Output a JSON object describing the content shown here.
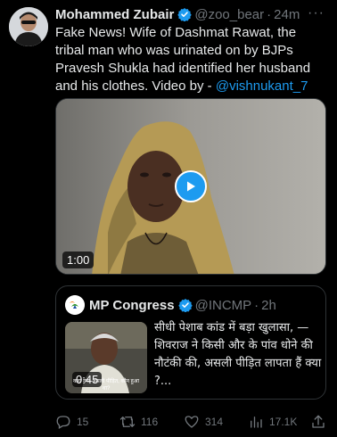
{
  "tweet": {
    "author_name": "Mohammed Zubair",
    "handle": "@zoo_bear",
    "separator": "·",
    "time": "24m",
    "more": "···",
    "text": "Fake News! Wife of Dashmat Rawat,  the tribal man who was urinated on by BJPs Pravesh Shukla had identified her husband and his clothes.  Video by - ",
    "mention": "@vishnukant_7",
    "video_duration": "1:00"
  },
  "quote": {
    "author_name": "MP Congress",
    "handle": "@INCMP",
    "separator": "·",
    "time": "2h",
    "text": "सीधी पेशाब कांड में बड़ा खुलासा, — शिवराज ने किसी और के पांव धोने की नौटंकी की, असली पीड़ित लापता हैं क्या ?...",
    "video_duration": "0:45",
    "thumb_caption": "कहां गया असली पीड़ित, कौन हुआ था?"
  },
  "actions": {
    "replies": "15",
    "retweets": "116",
    "likes": "314",
    "views": "17.1K"
  },
  "colors": {
    "background": "#000000",
    "text": "#e7e9ea",
    "muted": "#71767b",
    "accent": "#1d9bf0",
    "border": "#2f3336"
  },
  "icons": [
    "verified-badge-icon",
    "more-icon",
    "play-icon",
    "reply-icon",
    "retweet-icon",
    "like-icon",
    "views-icon",
    "share-icon"
  ]
}
